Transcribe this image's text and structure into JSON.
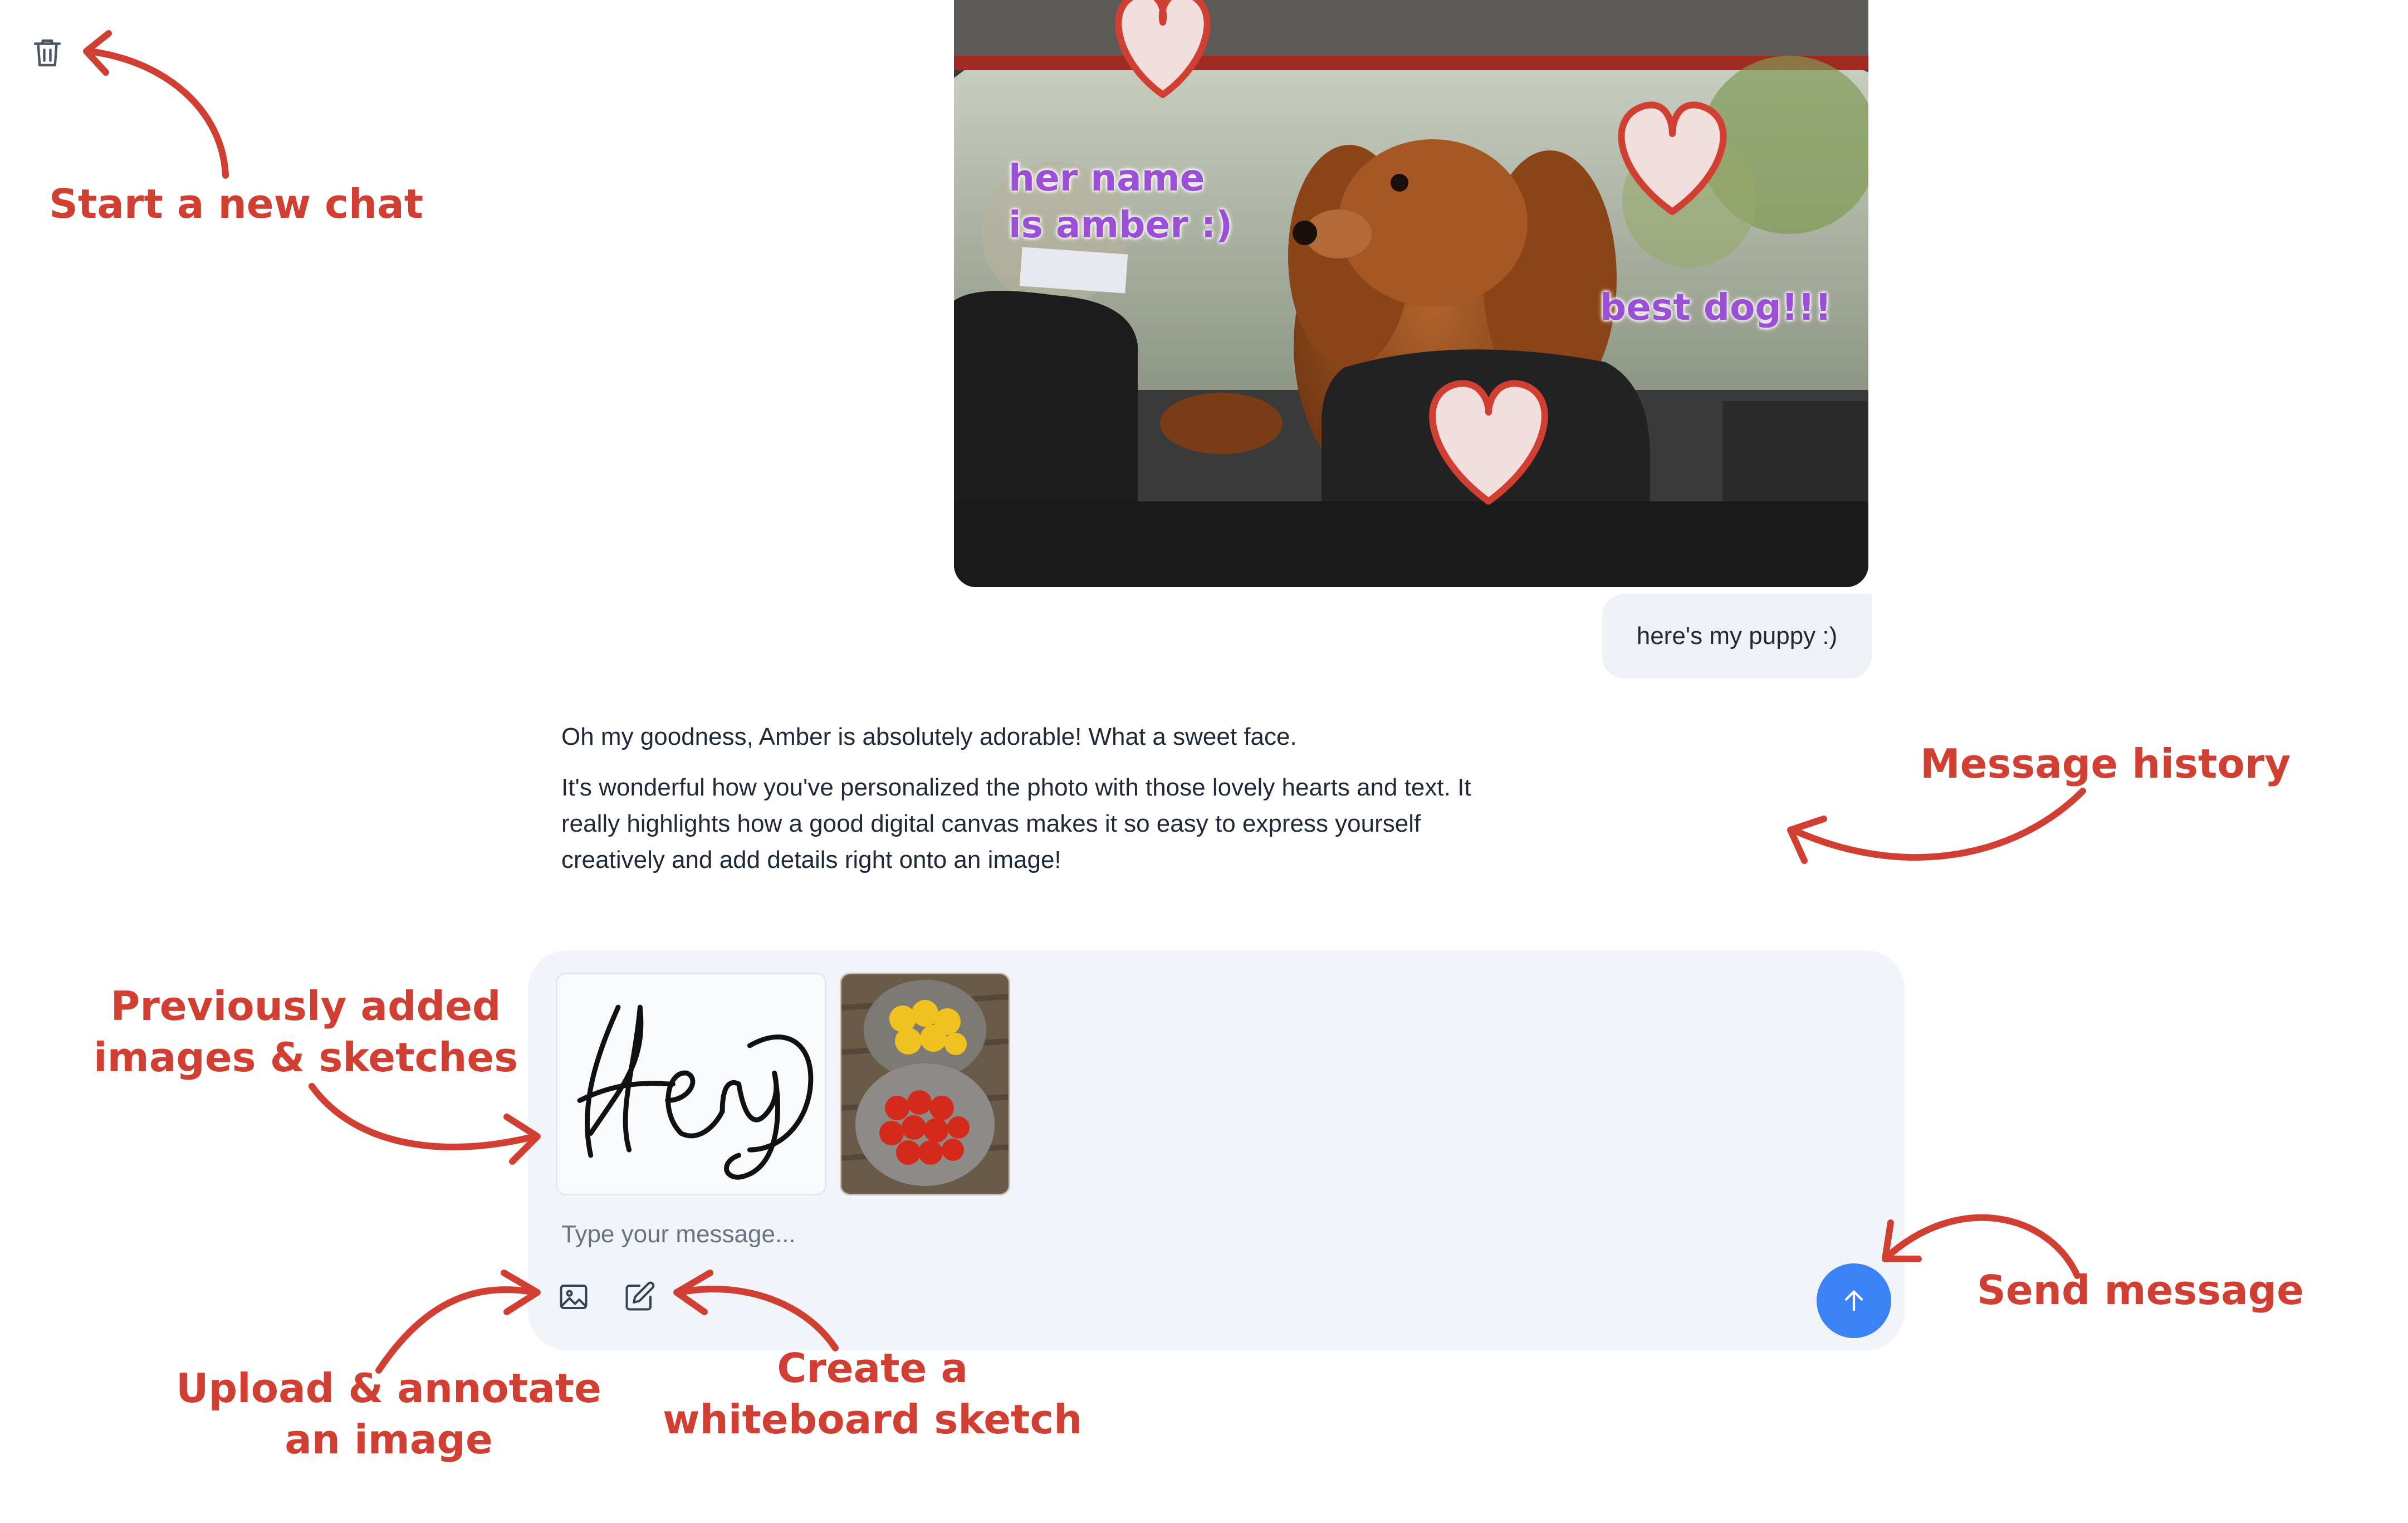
{
  "toolbar": {
    "new_chat_icon": "trash-icon"
  },
  "photo": {
    "alt": "here's my puppy :)",
    "labels": {
      "name_line1": "her name",
      "name_line2": "is amber :)",
      "best": "best dog!!!"
    }
  },
  "messages": {
    "user": "here's my puppy :)",
    "assistant": [
      "Oh my goodness, Amber is absolutely adorable! What a sweet face.",
      "It's wonderful how you've personalized the photo with those lovely hearts and text. It really highlights how a good digital canvas makes it so easy to express yourself creatively and add details right onto an image!"
    ]
  },
  "composer": {
    "placeholder": "Type your message...",
    "sketch_text": "Hey",
    "upload_icon": "image-upload-icon",
    "sketch_icon": "pencil-square-icon",
    "send_icon": "arrow-up-icon"
  },
  "annotations": {
    "new_chat": "Start a new chat",
    "history": "Message history",
    "previous_line1": "Previously added",
    "previous_line2": "images & sketches",
    "upload_line1": "Upload & annotate",
    "upload_line2": "an image",
    "whiteboard_line1": "Create a",
    "whiteboard_line2": "whiteboard sketch",
    "send": "Send message"
  },
  "colors": {
    "annotation": "#d13f32",
    "photo_label": "#9b4fd6",
    "send_button": "#3b82f6",
    "composer_bg": "#f1f4f9",
    "bubble_bg": "#eef2f7"
  }
}
